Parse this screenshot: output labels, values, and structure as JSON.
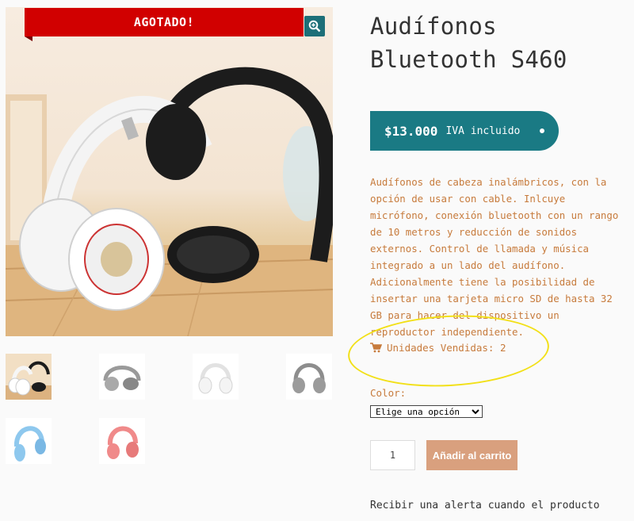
{
  "product": {
    "badge": "AGOTADO!",
    "title_line1": "Audífonos",
    "title_line2": "Bluetooth S460",
    "price": "$13.000",
    "price_suffix": "IVA incluido",
    "description": "Audífonos de cabeza inalámbricos, con la opción de usar con cable. Inlcuye micrófono, conexión bluetooth con un rango de 10 metros y reducción de sonidos externos. Control de llamada y música integrado a un lado del audífono. Adicionalmente tiene la posibilidad de insertar una tarjeta micro SD de hasta 32 GB para hacer del dispositivo un reproductor independiente.",
    "units_sold": "Unidades Vendidas: 2"
  },
  "options": {
    "color_label": "Color:",
    "color_selected": "Elige una opción"
  },
  "cart": {
    "quantity": "1",
    "add_button": "Añadir al carrito"
  },
  "alert": {
    "text": "Recibir una alerta cuando el producto"
  },
  "gallery": {
    "thumbnails": [
      {
        "color": "#e8e8e8",
        "icon": "headphones-white-black"
      },
      {
        "color": "#9a9a9a",
        "icon": "headphones-grey-folded"
      },
      {
        "color": "#ececec",
        "icon": "headphones-white"
      },
      {
        "color": "#8d8d8d",
        "icon": "headphones-grey"
      },
      {
        "color": "#8ec8ee",
        "icon": "headphones-blue"
      },
      {
        "color": "#f08a8a",
        "icon": "headphones-pink"
      }
    ]
  },
  "colors": {
    "badge": "#d10000",
    "price_bg": "#1a7a84",
    "accent_text": "#c77b3c",
    "cart_button": "#d9a07e",
    "highlight": "#f2e018"
  }
}
